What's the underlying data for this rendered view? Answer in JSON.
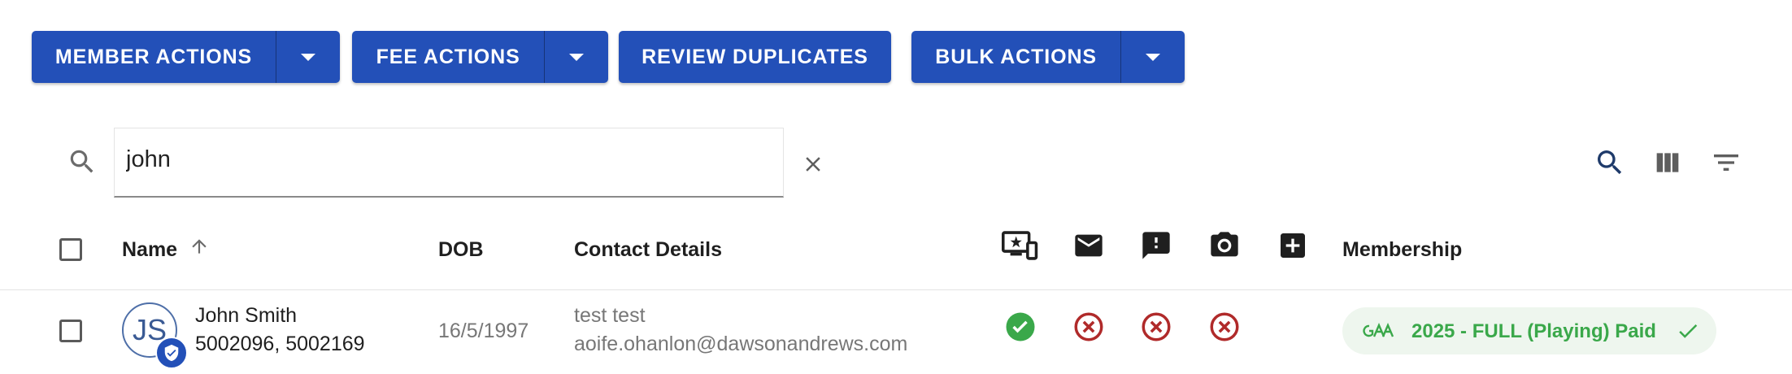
{
  "toolbar": {
    "member_actions_label": "MEMBER ACTIONS",
    "fee_actions_label": "FEE ACTIONS",
    "review_duplicates_label": "REVIEW DUPLICATES",
    "bulk_actions_label": "BULK ACTIONS"
  },
  "search": {
    "value": "john",
    "icons": [
      "search-icon",
      "close-icon",
      "search-icon",
      "view-column-icon",
      "filter-list-icon"
    ]
  },
  "table": {
    "columns": {
      "name": "Name",
      "dob": "DOB",
      "contact": "Contact Details",
      "membership": "Membership"
    },
    "column_icons": [
      "app-registration-icon",
      "email-icon",
      "feedback-icon",
      "camera-icon",
      "medical-cross-icon"
    ],
    "rows": [
      {
        "avatar_initials": "JS",
        "name": "John Smith",
        "ids": "5002096, 5002169",
        "dob": "16/5/1997",
        "contact_name": "test test",
        "email": "aoife.ohanlon@dawsonandrews.com",
        "statuses": [
          "check",
          "cancel",
          "cancel",
          "cancel"
        ],
        "membership": "2025 - FULL (Playing) Paid"
      }
    ]
  },
  "colors": {
    "primary": "#2350b8",
    "success": "#3aa84a",
    "error": "#b02a2a",
    "chip_bg": "#eef6ee"
  }
}
